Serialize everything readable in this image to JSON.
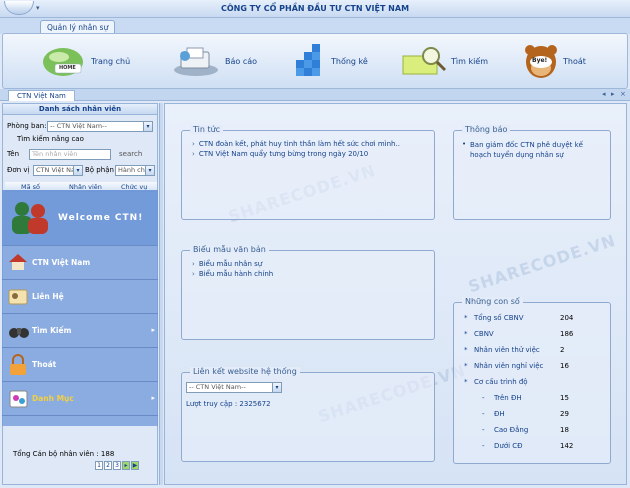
{
  "window": {
    "title": "CÔNG TY CỔ PHẦN ĐẦU TƯ CTN VIỆT NAM",
    "quick_access_arrow": "▾"
  },
  "ribbon": {
    "tab": "Quản lý nhân sự",
    "buttons": [
      {
        "label": "Trang chủ",
        "icon": "home-icon",
        "icon_text": "HOME"
      },
      {
        "label": "Báo cáo",
        "icon": "report-icon"
      },
      {
        "label": "Thống kê",
        "icon": "statistics-icon"
      },
      {
        "label": "Tìm kiếm",
        "icon": "search-icon"
      },
      {
        "label": "Thoát",
        "icon": "exit-icon",
        "icon_text": "Bye!"
      }
    ]
  },
  "doc_tab": {
    "label": "CTN Việt Nam",
    "nav": [
      "◂",
      "▸",
      "×"
    ]
  },
  "left_panel": {
    "header": "Danh sách nhân viên",
    "department_label": "Phòng ban:",
    "department_value": "-- CTN Việt Nam--",
    "advanced_search": "Tìm kiếm nâng cao",
    "name_label": "Tên",
    "name_placeholder": "Tên nhân viên",
    "search_button": "search",
    "unit_label": "Đơn vị",
    "unit_value": "CTN Việt Na",
    "dept_label": "Bộ phận",
    "dept_value": "Hành chín",
    "grid_columns": [
      "Mã số",
      "Nhân viên",
      "Chức vụ"
    ],
    "total": "Tổng Cán bộ nhân viên : 188",
    "pager": [
      "1",
      "2",
      "3",
      "▸",
      "▶"
    ]
  },
  "menu": {
    "welcome": "Welcome CTN!",
    "items": [
      {
        "label": "CTN Việt Nam",
        "icon": "house-icon",
        "chevron": ""
      },
      {
        "label": "Liên Hệ",
        "icon": "contact-card-icon",
        "chevron": ""
      },
      {
        "label": "Tìm Kiếm",
        "icon": "binoculars-icon",
        "chevron": "▸"
      },
      {
        "label": "Thoát",
        "icon": "lock-icon",
        "chevron": ""
      },
      {
        "label": "Danh Mục",
        "icon": "paint-icon",
        "chevron": "▸"
      }
    ]
  },
  "news": {
    "title": "Tin tức",
    "items": [
      "CTN đoàn kết, phát huy tinh thần làm hết sức chơi mình..",
      "CTN Việt Nam quẩy tưng bừng trong ngày 20/10"
    ]
  },
  "notice": {
    "title": "Thông báo",
    "items": [
      "Ban giám đốc CTN phê duyệt kế hoạch tuyển dụng nhân sự"
    ]
  },
  "forms": {
    "title": "Biểu mẫu văn bản",
    "items": [
      "Biểu mẫu nhân sự",
      "Biểu mẫu hành chính"
    ]
  },
  "links": {
    "title": "Liên kết website hệ thống",
    "select_value": "-- CTN Việt Nam--",
    "visits": "Lượt truy cập : 2325672"
  },
  "stats": {
    "title": "Những con số",
    "rows": [
      {
        "label": "Tổng số CBNV",
        "value": "204"
      },
      {
        "label": "CBNV",
        "value": "186"
      },
      {
        "label": "Nhân viên thử việc",
        "value": "2"
      },
      {
        "label": "Nhân viên nghỉ việc",
        "value": "16"
      },
      {
        "label": "Cơ cấu trình độ",
        "value": ""
      },
      {
        "label": "Trên ĐH",
        "value": "15"
      },
      {
        "label": "ĐH",
        "value": "29"
      },
      {
        "label": "Cao Đẳng",
        "value": "18"
      },
      {
        "label": "Dưới CĐ",
        "value": "142"
      }
    ]
  },
  "watermark": "SHARECODE.VN",
  "colors": {
    "accent": "#15428b",
    "panel": "#dfe8f6",
    "menu": "#739bda"
  }
}
